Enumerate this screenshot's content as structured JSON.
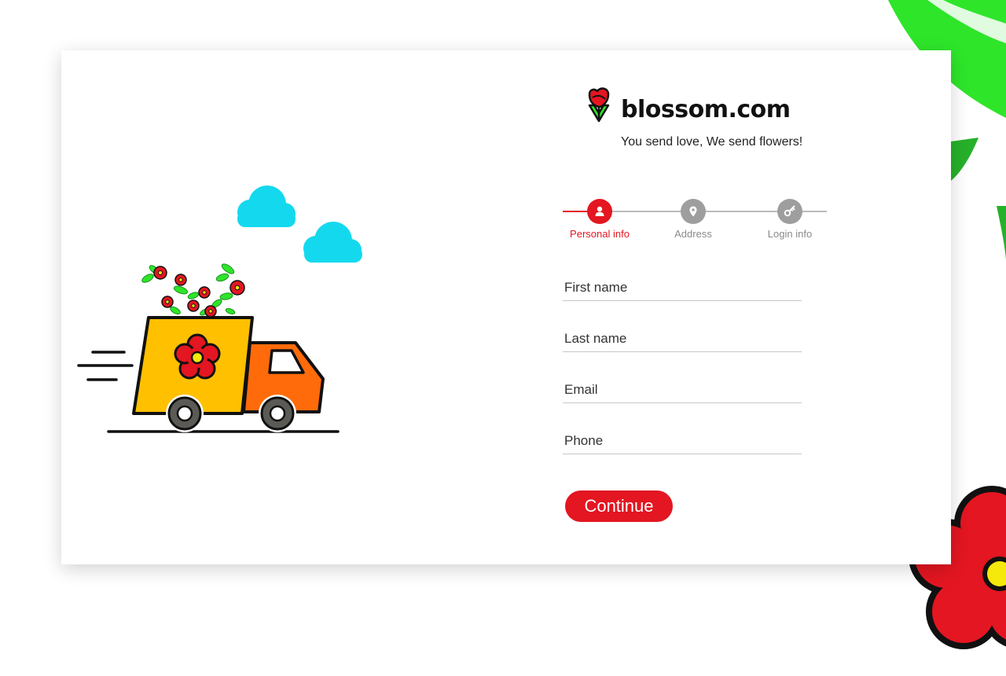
{
  "brand": {
    "name": "blossom.com",
    "tagline": "You send love, We send flowers!"
  },
  "colors": {
    "accent": "#e31621",
    "inactive": "#9e9e9e",
    "leaf": "#2ee52a",
    "cloud": "#14d9ee",
    "truck_box": "#ffc000",
    "truck_cab": "#ff6b0a"
  },
  "stepper": {
    "steps": [
      {
        "label": "Personal info",
        "icon": "user-icon",
        "active": true
      },
      {
        "label": "Address",
        "icon": "location-pin-icon",
        "active": false
      },
      {
        "label": "Login info",
        "icon": "key-icon",
        "active": false
      }
    ]
  },
  "form": {
    "first_name": {
      "placeholder": "First name",
      "value": ""
    },
    "last_name": {
      "placeholder": "Last name",
      "value": ""
    },
    "email": {
      "placeholder": "Email",
      "value": ""
    },
    "phone": {
      "placeholder": "Phone",
      "value": ""
    }
  },
  "actions": {
    "continue_label": "Continue"
  }
}
